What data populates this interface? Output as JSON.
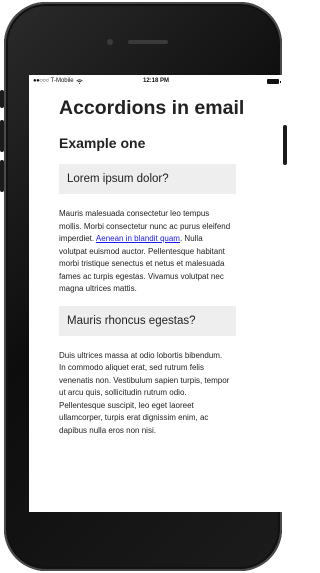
{
  "status_bar": {
    "signal": "●●○○○",
    "carrier": "T-Mobile",
    "wifi_icon": "wifi-icon",
    "time": "12:18 PM",
    "battery_icon": "battery-icon"
  },
  "page": {
    "title": "Accordions in email",
    "section_title": "Example one"
  },
  "accordions": [
    {
      "title": "Lorem ipsum dolor?",
      "text_before_link": "Mauris malesuada consectetur leo tempus mollis. Morbi consectetur nunc ac purus eleifend imperdiet. ",
      "link_text": "Aenean in blandit quam",
      "text_after_link": ". Nulla volutpat euismod auctor. Pellentesque habitant morbi tristique senectus et netus et malesuada fames ac turpis egestas. Vivamus volutpat nec magna ultrices mattis."
    },
    {
      "title": "Mauris rhoncus egestas?",
      "text": "Duis ultrices massa at odio lobortis bibendum. In commodo aliquet erat, sed rutrum felis venenatis non. Vestibulum sapien turpis, tempor ut arcu quis, sollicitudin rutrum odio. Pellentesque suscipit, leo eget laoreet ullamcorper, turpis erat dignissim enim, ac dapibus nulla eros non nisi."
    }
  ],
  "colors": {
    "phone_body": "#1a1a1a",
    "accordion_header_bg": "#eeeeee",
    "link": "#1a1aee"
  }
}
